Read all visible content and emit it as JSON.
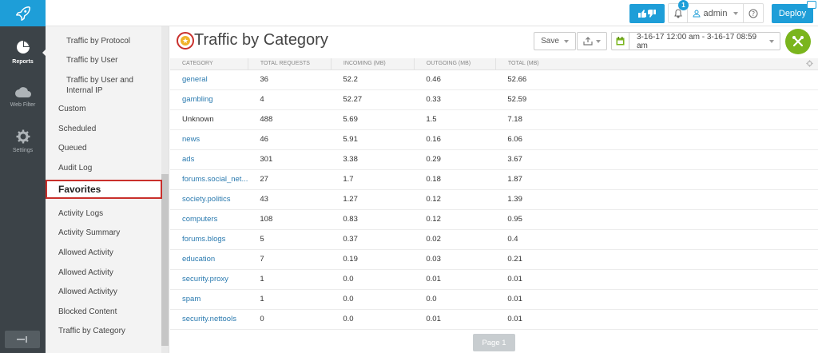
{
  "topbar": {
    "admin_label": "admin",
    "notification_count": "1",
    "deploy_label": "Deploy",
    "accent": "#1e9ed8"
  },
  "rail": {
    "items": [
      {
        "label": "Reports",
        "icon": "pie-chart-icon"
      },
      {
        "label": "Web Filter",
        "icon": "cloud-icon"
      },
      {
        "label": "Settings",
        "icon": "gear-icon"
      }
    ]
  },
  "sidemenu": {
    "items": [
      "Traffic by Protocol",
      "Traffic by User",
      "Traffic by User and Internal IP",
      "Custom",
      "Scheduled",
      "Queued",
      "Audit Log",
      "Favorites",
      "Activity Logs",
      "Activity Summary",
      "Allowed Activity",
      "Allowed Activity",
      "Allowed Activityy",
      "Blocked Content",
      "Traffic by Category"
    ]
  },
  "main": {
    "title": "Traffic by Category",
    "save_label": "Save",
    "date_range": "3-16-17 12:00 am - 3-16-17 08:59 am",
    "page_label": "Page 1"
  },
  "table": {
    "columns": [
      "CATEGORY",
      "TOTAL REQUESTS",
      "INCOMING (MB)",
      "OUTGOING (MB)",
      "TOTAL (MB)"
    ],
    "rows": [
      [
        "general",
        "36",
        "52.2",
        "0.46",
        "52.66"
      ],
      [
        "gambling",
        "4",
        "52.27",
        "0.33",
        "52.59"
      ],
      [
        "Unknown",
        "488",
        "5.69",
        "1.5",
        "7.18"
      ],
      [
        "news",
        "46",
        "5.91",
        "0.16",
        "6.06"
      ],
      [
        "ads",
        "301",
        "3.38",
        "0.29",
        "3.67"
      ],
      [
        "forums.social_net...",
        "27",
        "1.7",
        "0.18",
        "1.87"
      ],
      [
        "society.politics",
        "43",
        "1.27",
        "0.12",
        "1.39"
      ],
      [
        "computers",
        "108",
        "0.83",
        "0.12",
        "0.95"
      ],
      [
        "forums.blogs",
        "5",
        "0.37",
        "0.02",
        "0.4"
      ],
      [
        "education",
        "7",
        "0.19",
        "0.03",
        "0.21"
      ],
      [
        "security.proxy",
        "1",
        "0.0",
        "0.01",
        "0.01"
      ],
      [
        "spam",
        "1",
        "0.0",
        "0.0",
        "0.01"
      ],
      [
        "security.nettools",
        "0",
        "0.0",
        "0.01",
        "0.01"
      ]
    ]
  }
}
